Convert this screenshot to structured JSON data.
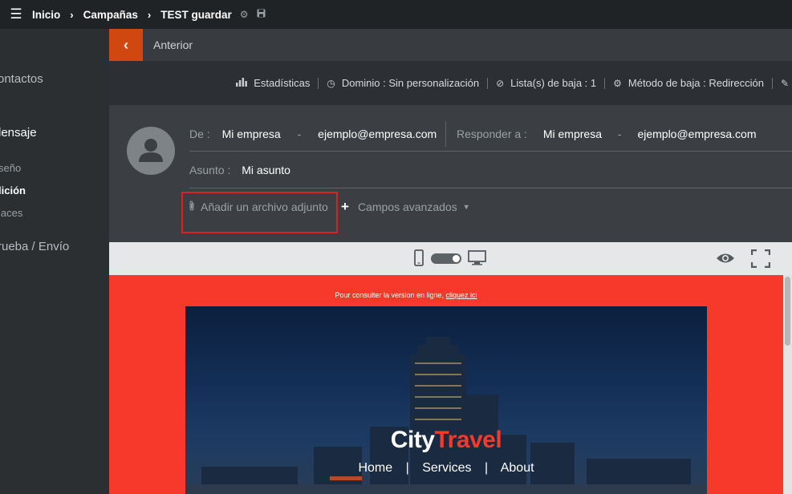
{
  "topbar": {
    "menu_icon": "hamburger-icon",
    "breadcrumbs": [
      "Inicio",
      "Campañas",
      "TEST guardar"
    ],
    "icons": [
      "gear-icon",
      "save-icon"
    ]
  },
  "sidebar": {
    "items": [
      {
        "label": "ontactos"
      },
      {
        "label": "lensaje"
      },
      {
        "label": "seño"
      },
      {
        "label": "lición"
      },
      {
        "label": "laces"
      },
      {
        "label": "rueba / Envío"
      }
    ]
  },
  "nav": {
    "previous_label": "Anterior"
  },
  "stats_bar": {
    "items": [
      {
        "icon": "bar-chart-icon",
        "label": "Estadísticas"
      },
      {
        "icon": "clock-icon",
        "label": "Dominio : Sin personalización"
      },
      {
        "icon": "ban-icon",
        "label": "Lista(s) de baja : 1"
      },
      {
        "icon": "gear-icon",
        "label": "Método de baja : Redirección"
      }
    ]
  },
  "message_header": {
    "from_label": "De :",
    "from_name": "Mi empresa",
    "from_sep": "-",
    "from_email": "ejemplo@empresa.com",
    "reply_label": "Responder a :",
    "reply_name": "Mi empresa",
    "reply_sep": "-",
    "reply_email": "ejemplo@empresa.com",
    "subject_label": "Asunto :",
    "subject_value": "Mi asunto",
    "attach_label": "Añadir un archivo adjunto",
    "advanced_label": "Campos avanzados"
  },
  "preview": {
    "device_toggle": "mobile",
    "online_text": "Pour consulter la version en ligne,",
    "online_link": "cliquez ici",
    "brand_first": "City",
    "brand_second": "Travel",
    "brand_accent": "#f5392c",
    "menu": [
      "Home",
      "Services",
      "About"
    ],
    "menu_sep": "|"
  }
}
